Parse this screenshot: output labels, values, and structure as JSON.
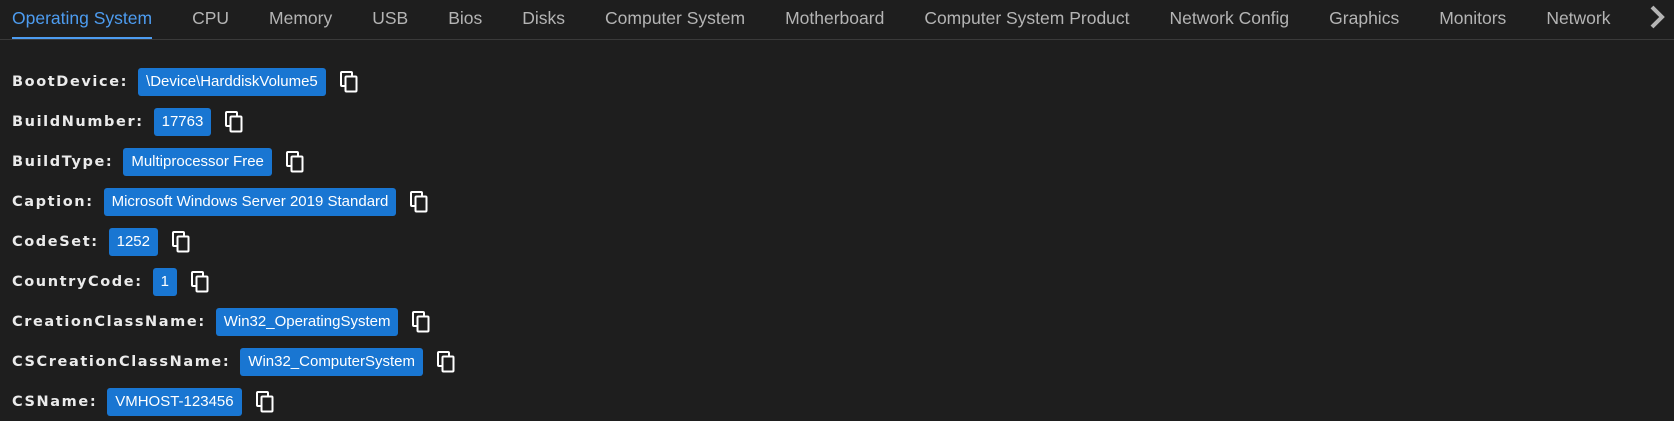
{
  "tabs": [
    {
      "label": "Operating System",
      "active": true
    },
    {
      "label": "CPU",
      "active": false
    },
    {
      "label": "Memory",
      "active": false
    },
    {
      "label": "USB",
      "active": false
    },
    {
      "label": "Bios",
      "active": false
    },
    {
      "label": "Disks",
      "active": false
    },
    {
      "label": "Computer System",
      "active": false
    },
    {
      "label": "Motherboard",
      "active": false
    },
    {
      "label": "Computer System Product",
      "active": false
    },
    {
      "label": "Network Config",
      "active": false
    },
    {
      "label": "Graphics",
      "active": false
    },
    {
      "label": "Monitors",
      "active": false
    },
    {
      "label": "Network",
      "active": false
    }
  ],
  "properties": [
    {
      "label": "BootDevice:",
      "value": "\\Device\\HarddiskVolume5"
    },
    {
      "label": "BuildNumber:",
      "value": "17763"
    },
    {
      "label": "BuildType:",
      "value": "Multiprocessor Free"
    },
    {
      "label": "Caption:",
      "value": "Microsoft Windows Server 2019 Standard"
    },
    {
      "label": "CodeSet:",
      "value": "1252"
    },
    {
      "label": "CountryCode:",
      "value": "1"
    },
    {
      "label": "CreationClassName:",
      "value": "Win32_OperatingSystem"
    },
    {
      "label": "CSCreationClassName:",
      "value": "Win32_ComputerSystem"
    },
    {
      "label": "CSName:",
      "value": "VMHOST-123456"
    }
  ],
  "colors": {
    "background": "#1e1e1e",
    "accent": "#4d9cf0",
    "chip": "#1976d2",
    "tab_text": "#b4b4b4",
    "label_text": "#ebebeb"
  },
  "icons": {
    "copy": "copy-icon",
    "scroll": "chevron-right-icon"
  }
}
